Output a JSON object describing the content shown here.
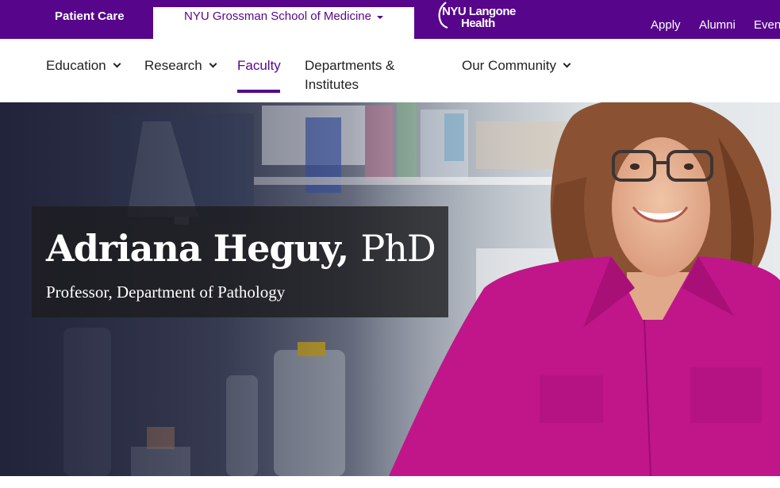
{
  "topbar": {
    "patient_care": "Patient Care",
    "school_tab": "NYU Grossman School of Medicine",
    "logo_line1": "NYU Langone",
    "logo_line2": "Health",
    "apply": "Apply",
    "alumni": "Alumni",
    "events": "Events"
  },
  "nav": {
    "items": [
      {
        "label": "Education"
      },
      {
        "label": "Research"
      },
      {
        "label": "Faculty"
      },
      {
        "label": "Departments & Institutes"
      },
      {
        "label": "Our Community"
      }
    ],
    "departments_line1": "Departments &",
    "departments_line2": "Institutes"
  },
  "hero": {
    "name": "Adriana Heguy,",
    "degree": "PhD",
    "title": "Professor, Department of Pathology"
  },
  "colors": {
    "brand_purple": "#57068c",
    "shirt_magenta": "#c0168a"
  },
  "icons": [
    "chevron-down-icon",
    "caret-down-icon",
    "nyu-torch-logo-icon"
  ]
}
